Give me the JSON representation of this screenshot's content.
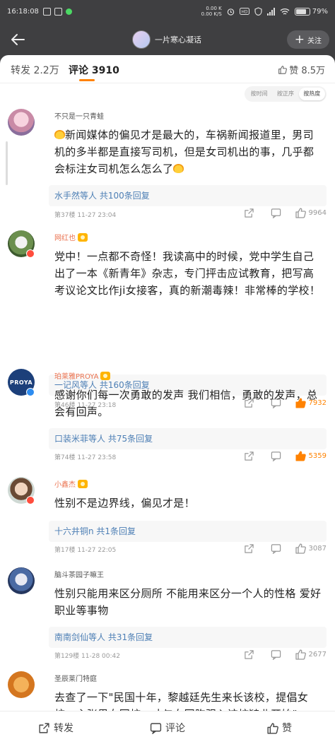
{
  "status_bar": {
    "time": "16:18:08",
    "net_speed_top": "0.00 K",
    "net_speed_bottom": "0.00 K/S",
    "battery": "79%"
  },
  "header": {
    "title": "一片寒心凝话",
    "follow_label": "关注"
  },
  "tabs": {
    "repost": "转发 2.2万",
    "comments": "评论 3910",
    "likes": "赞 8.5万"
  },
  "sort": {
    "options": [
      "按时间",
      "按正序",
      "按热度"
    ],
    "active": "按热度"
  },
  "comments": [
    {
      "user": "不只是一只青蛙",
      "highlight_name": false,
      "text_before": "",
      "text": "新闻媒体的偏见才是最大的，车祸新闻报道里，男司机的多半都是直接写司机，但是女司机出的事，几乎都会标注女司机怎么怎么了",
      "replies": "水手然等人 共100条回复",
      "meta": "第37楼  11-27 23:04",
      "likes": "9964",
      "hot": false
    },
    {
      "user": "网红也",
      "highlight_name": true,
      "text": "党中！一点都不奇怪！我读高中的时候，党中学生自己出了一本《新青年》杂志，专门抨击应试教育，把写高考议论文比作ji女接客，真的新潮毒辣！非常棒的学校！",
      "replies": "一记风等人 共160条回复",
      "meta": "第46楼  11-27 23:18",
      "likes": "7932",
      "hot": true
    },
    {
      "user": "珀莱雅PROYA",
      "highlight_name": true,
      "avatar_text": "PROYA",
      "text": "感谢你们每一次勇敢的发声 我们相信，勇敢的发声，总会有回声。",
      "replies": "口装米菲等人 共75条回复",
      "meta": "第74楼  11-27 23:58",
      "likes": "5359",
      "hot": true
    },
    {
      "user": "小鑫杰",
      "highlight_name": true,
      "text": "性别不是边界线，偏见才是！",
      "replies": "十六井铜n 共1条回复",
      "meta": "第17楼  11-27 22:05",
      "likes": "3087",
      "hot": false
    },
    {
      "user": "脑斗茶园子嘛王",
      "highlight_name": false,
      "text": "性别只能用来区分厕所 不能用来区分一个人的性格 爱好 职业等事物",
      "replies": "南南剑仙等人 共31条回复",
      "meta": "第129楼  11-28 00:42",
      "likes": "2677",
      "hot": false
    },
    {
      "user": "圣辰莱门特庭",
      "highlight_name": false,
      "text": "去查了一下\"民国十年，黎越廷先生来长该校，提倡女校，主张男女同校，才与女同胞强入该校肄业开始\"",
      "replies": "",
      "meta": "",
      "likes": "",
      "hot": false
    }
  ],
  "bottom_bar": {
    "repost": "转发",
    "comment": "评论",
    "like": "赞"
  },
  "colors": {
    "accent": "#ff8200",
    "link": "#4d7fb5",
    "highlight_name": "#eb7350"
  }
}
